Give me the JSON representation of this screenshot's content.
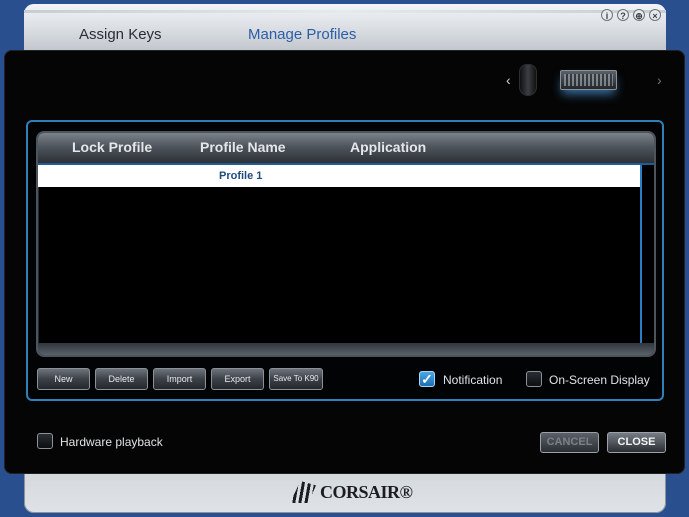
{
  "window": {
    "controls": [
      {
        "name": "info-icon",
        "glyph": "i"
      },
      {
        "name": "help-icon",
        "glyph": "?"
      },
      {
        "name": "globe-icon",
        "glyph": "⊕"
      },
      {
        "name": "close-window-icon",
        "glyph": "×"
      }
    ]
  },
  "tabs": {
    "assign_keys": "Assign Keys",
    "manage_profiles": "Manage Profiles"
  },
  "device_nav": {
    "prev": "‹",
    "next": "›"
  },
  "table": {
    "headers": {
      "lock": "Lock Profile",
      "name": "Profile Name",
      "application": "Application"
    },
    "rows": [
      {
        "lock": "",
        "name": "Profile 1",
        "application": ""
      }
    ]
  },
  "actions": {
    "new": "New",
    "delete": "Delete",
    "import": "Import",
    "export": "Export",
    "save": "Save To K90"
  },
  "options": {
    "notification": {
      "label": "Notification",
      "checked": true
    },
    "osd": {
      "label": "On-Screen Display",
      "checked": false
    },
    "hardware_playback": {
      "label": "Hardware playback",
      "checked": false
    }
  },
  "footer": {
    "cancel": "CANCEL",
    "close": "CLOSE",
    "logo": "CORSAIR®"
  },
  "colors": {
    "accent": "#2f7fb8",
    "active_tab": "#2c5da8"
  }
}
